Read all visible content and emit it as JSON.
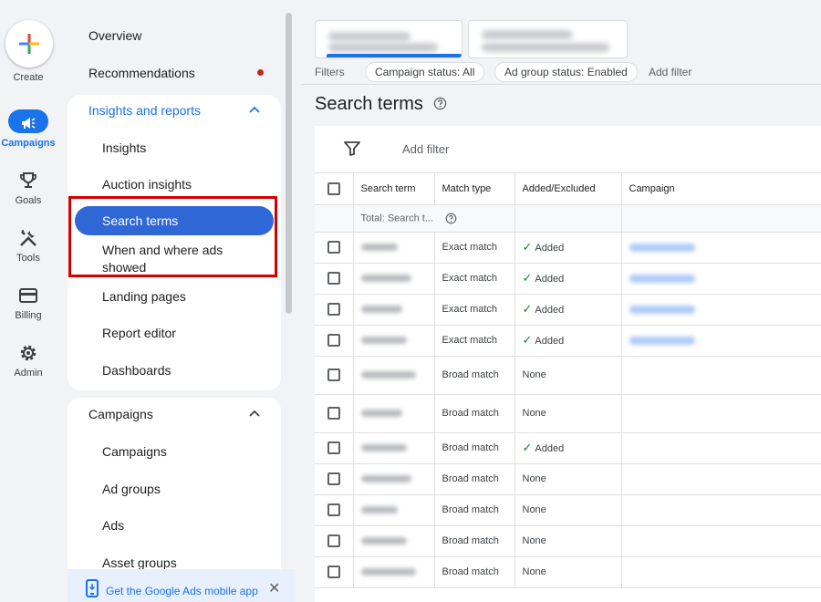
{
  "rail": {
    "create_label": "Create",
    "items": [
      {
        "label": "Campaigns",
        "icon": "campaigns-icon"
      },
      {
        "label": "Goals",
        "icon": "trophy-icon"
      },
      {
        "label": "Tools",
        "icon": "tools-icon"
      },
      {
        "label": "Billing",
        "icon": "credit-card-icon"
      },
      {
        "label": "Admin",
        "icon": "gear-icon"
      }
    ]
  },
  "nav": {
    "overview": "Overview",
    "recommendations": "Recommendations",
    "insights_section": {
      "title": "Insights and reports",
      "items": [
        "Insights",
        "Auction insights",
        "Search terms",
        "When and where ads showed",
        "Landing pages",
        "Report editor",
        "Dashboards"
      ]
    },
    "campaigns_section": {
      "title": "Campaigns",
      "items": [
        "Campaigns",
        "Ad groups",
        "Ads",
        "Asset groups"
      ]
    },
    "banner_text": "Get the Google Ads mobile app"
  },
  "main": {
    "filters_label": "Filters",
    "chips": [
      "Campaign status: All",
      "Ad group status: Enabled"
    ],
    "add_filter_top": "Add filter",
    "page_title": "Search terms",
    "add_filter": "Add filter",
    "columns": [
      "Search term",
      "Match type",
      "Added/Excluded",
      "Campaign"
    ],
    "total_label": "Total: Search t...",
    "rows": [
      {
        "match": "Exact match",
        "status": "Added"
      },
      {
        "match": "Exact match",
        "status": "Added"
      },
      {
        "match": "Exact match",
        "status": "Added"
      },
      {
        "match": "Exact match",
        "status": "Added"
      },
      {
        "match": "Broad match",
        "status": "None"
      },
      {
        "match": "Broad match",
        "status": "None"
      },
      {
        "match": "Broad match",
        "status": "Added"
      },
      {
        "match": "Broad match",
        "status": "None"
      },
      {
        "match": "Broad match",
        "status": "None"
      },
      {
        "match": "Broad match",
        "status": "None"
      },
      {
        "match": "Broad match",
        "status": "None"
      }
    ]
  },
  "colors": {
    "accent": "#1a73e8",
    "selected_nav": "#2f67d6",
    "highlight": "#d40000",
    "added_check": "#188038"
  }
}
